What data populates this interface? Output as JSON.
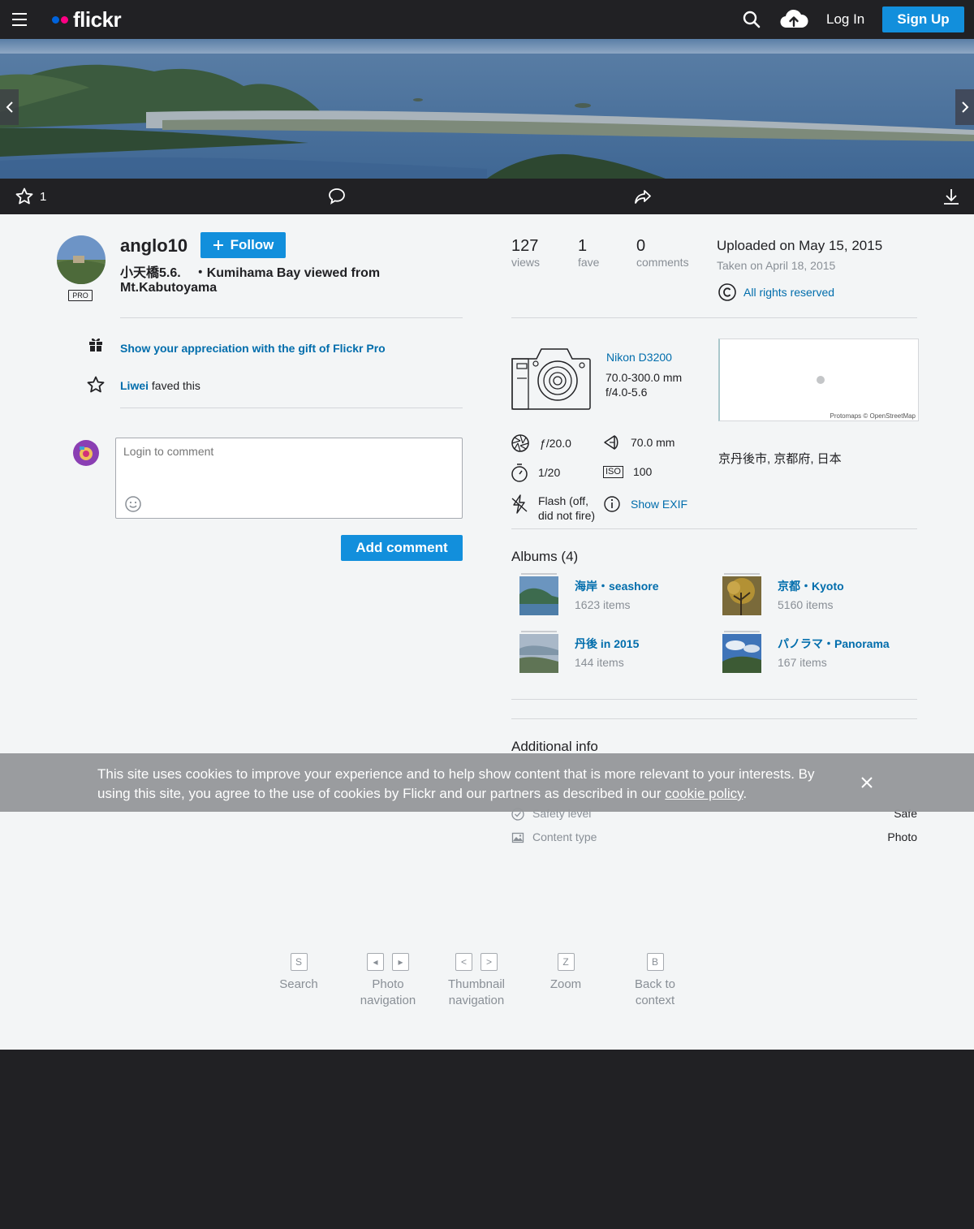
{
  "nav": {
    "logo_text": "flickr",
    "login_label": "Log In",
    "signup_label": "Sign Up"
  },
  "actions": {
    "fave_count": "1"
  },
  "owner": {
    "username": "anglo10",
    "pro_badge": "PRO",
    "follow_label": "Follow"
  },
  "photo": {
    "title": "小天橋5.6.　・Kumihama Bay viewed from Mt.Kabutoyama"
  },
  "gift": {
    "text": "Show your appreciation with the gift of Flickr Pro"
  },
  "fave": {
    "user": "Liwei",
    "suffix": " faved this"
  },
  "comment": {
    "placeholder": "Login to comment",
    "button": "Add comment"
  },
  "stats": {
    "views": {
      "value": "127",
      "label": "views"
    },
    "faves": {
      "value": "1",
      "label": "fave"
    },
    "comments": {
      "value": "0",
      "label": "comments"
    }
  },
  "dates": {
    "uploaded": "Uploaded on May 15, 2015",
    "taken": "Taken on April 18, 2015"
  },
  "license": {
    "text": "All rights reserved"
  },
  "camera": {
    "name": "Nikon D3200",
    "lens_line1": "70.0-300.0 mm",
    "lens_line2": "f/4.0-5.6"
  },
  "map": {
    "credit": "Protomaps © OpenStreetMap"
  },
  "location": "京丹後市, 京都府, 日本",
  "exif": {
    "aperture": "ƒ/20.0",
    "focal_length": "70.0 mm",
    "shutter": "1/20",
    "iso_label": "ISO",
    "iso": "100",
    "flash_line1": "Flash (off,",
    "flash_line2": "did not fire)",
    "show_exif": "Show EXIF"
  },
  "albums": {
    "title": "Albums (4)",
    "items": [
      {
        "name": "海岸・seashore",
        "count": "1623 items"
      },
      {
        "name": "京都・Kyoto",
        "count": "5160 items"
      },
      {
        "name": "丹後 in 2015",
        "count": "144 items"
      },
      {
        "name": "パノラマ・Panorama",
        "count": "167 items"
      }
    ]
  },
  "additional_info": {
    "title": "Additional info",
    "rows": [
      {
        "label": "Safety level",
        "value": "Safe"
      },
      {
        "label": "Content type",
        "value": "Photo"
      }
    ]
  },
  "cookie": {
    "text": "This site uses cookies to improve your experience and to help show content that is more relevant to your interests. By using this site, you agree to the use of cookies by Flickr and our partners as described in our ",
    "link": "cookie policy",
    "end": "."
  },
  "shortcuts": [
    {
      "keys": [
        "S"
      ],
      "line1": "Search",
      "line2": ""
    },
    {
      "keys": [
        "◂",
        "▸"
      ],
      "line1": "Photo",
      "line2": "navigation"
    },
    {
      "keys": [
        "<",
        ">"
      ],
      "line1": "Thumbnail",
      "line2": "navigation"
    },
    {
      "keys": [
        "Z"
      ],
      "line1": "Zoom",
      "line2": ""
    },
    {
      "keys": [
        "B"
      ],
      "line1": "Back to",
      "line2": "context"
    }
  ],
  "colors": {
    "brand_blue": "#0063dc",
    "brand_pink": "#ff0084",
    "button_blue": "#128fdc",
    "link_blue": "#006dac"
  }
}
